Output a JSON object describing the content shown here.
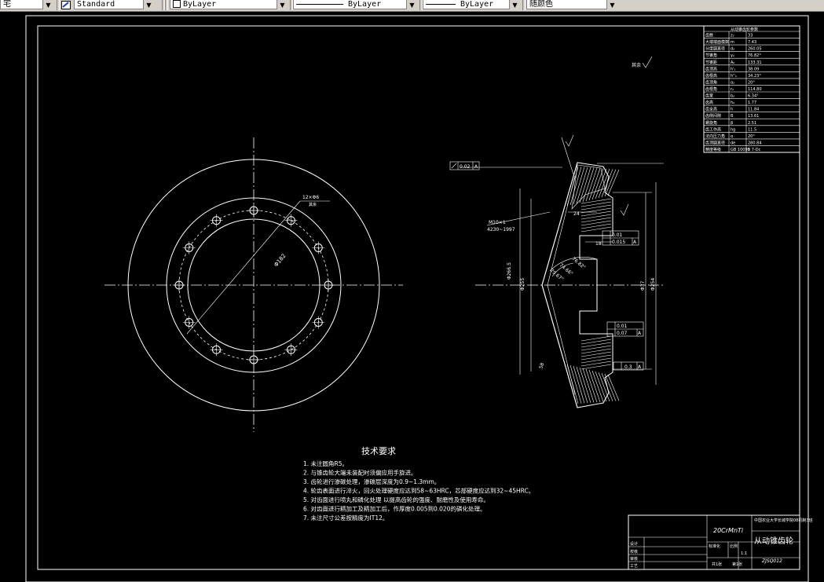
{
  "toolbar": {
    "left_fragment": "宅",
    "textstyle_value": "Standard",
    "layer_value": "ByLayer",
    "linetype_value": "ByLayer",
    "lineweight_value": "ByLayer",
    "color_value": "随颜色"
  },
  "drawing": {
    "title_block": {
      "material": "20CrMnTi",
      "school": "中国农业大学长城学院08机制3班",
      "part_name": "从动锥齿轮",
      "drawing_number": "ZJSQ012",
      "scale": "1:1",
      "labels": [
        "设计",
        "校核",
        "审核",
        "工艺",
        "标准化",
        "比例",
        "共1张",
        "第1张"
      ]
    },
    "tech_requirements": {
      "title": "技术要求",
      "items": [
        "1. 未注圆角R5。",
        "2. 与锥齿轮大端未装配时须偏应用手旋进。",
        "3. 齿轮进行渗碳处理，渗碳层深度为0.9~1.3mm。",
        "4. 轮齿表面进行淬火，回火处理硬度应达到58~63HRC，芯部硬度应达到32~45HRC。",
        "5. 对齿面进行喷丸和磷化处理 以提高齿轮的强度、耐磨性及使用寿命。",
        "6. 对齿面进行精加工及精加工后，作厚度0.005到0.020的磷化处理。",
        "7. 未注尺寸公差按精度为IT12。"
      ]
    },
    "params_table": {
      "header": "从动锥齿轮参数",
      "rows": [
        [
          "齿数",
          "z₂",
          "33"
        ],
        [
          "大端端面模数",
          "m",
          "7.43"
        ],
        [
          "分度圆直径",
          "d₂",
          "260.05"
        ],
        [
          "节锥角",
          "γ₂",
          "76.82°"
        ],
        [
          "节锥距",
          "A₀",
          "133.31"
        ],
        [
          "齿顶高",
          "h'₂",
          "38.09"
        ],
        [
          "齿根高",
          "h''₂",
          "34.23°"
        ],
        [
          "齿顶角",
          "α₂",
          "20°"
        ],
        [
          "齿根角",
          "r₂",
          "114.80"
        ],
        [
          "齿宽",
          "b₂",
          "6.34°"
        ],
        [
          "齿高",
          "h₂",
          "1.77"
        ],
        [
          "齿全高",
          "h",
          "11.84"
        ],
        [
          "齿侧间隙",
          "B",
          "13.61"
        ],
        [
          "螺旋角",
          "β",
          "2.51"
        ],
        [
          "齿工作高",
          "hg",
          "11.5"
        ],
        [
          "法向压力角",
          "α",
          "20°"
        ],
        [
          "齿顶圆直径",
          "de",
          "280.84"
        ],
        [
          "精度等级",
          "GB 10095",
          "8 7-Dc"
        ]
      ]
    },
    "annotations": {
      "hole_note": "12×Φ6",
      "pcd_dia": "Φ182",
      "roughness_other": "其余",
      "tol_flatness": "0.02",
      "tol_perp": "0.01",
      "tol_runout": "0.015",
      "tol_parallel": "0.01",
      "tol_perp2": "0.07",
      "tol_bottom": "0.3",
      "datum": "A",
      "bore_dim": "Φ37",
      "outer_dim": "Φ255",
      "dia_dim": "Φ254",
      "pitch_dim": "Φ266.5",
      "angle1": "76.82°",
      "angle2": "74.66°",
      "angle3": "79.67°",
      "dim_24": "24",
      "dim_18": "18",
      "dim_58": "58",
      "thread_note": "M10×1",
      "gb_note": "4230~1997"
    }
  }
}
